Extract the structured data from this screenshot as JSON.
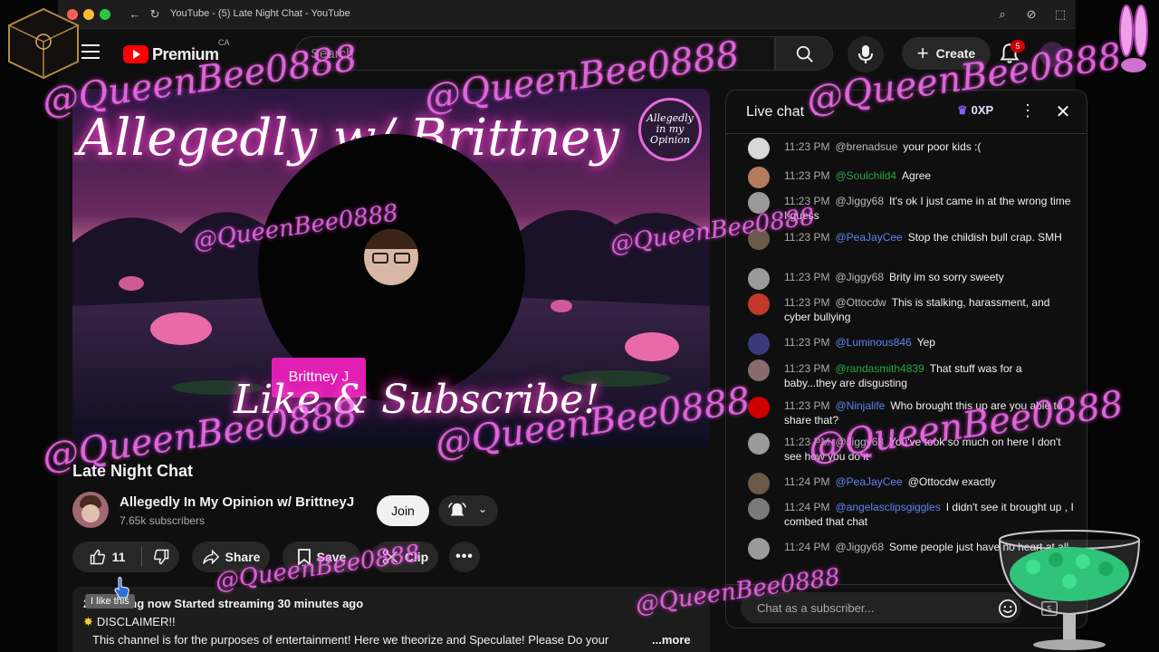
{
  "browser": {
    "tab_title": "YouTube - (5) Late Night Chat - YouTube"
  },
  "header": {
    "logo_text": "Premium",
    "logo_region": "CA",
    "search_placeholder": "Search",
    "create_label": "Create",
    "notification_count": "5"
  },
  "player": {
    "banner_title": "Allegedly w/ Brittney J",
    "banner_subtitle": "Like & Subscribe!",
    "round_logo_text": "Allegedly in my Opinion",
    "host_tag": "Brittney J"
  },
  "video": {
    "title": "Late Night Chat",
    "channel_name": "Allegedly In My Opinion w/ BrittneyJ",
    "subscribers": "7.65k subscribers",
    "join_label": "Join",
    "like_count": "11",
    "share_label": "Share",
    "save_label": "Save",
    "clip_label": "Clip",
    "tooltip": "I like this",
    "desc_line1": "2 watching now  Started streaming 30 minutes ago",
    "desc_line2": "DISCLAIMER!!",
    "desc_line3": "This channel is for the purposes of entertainment!  Here we theorize and Speculate!  Please Do your",
    "desc_more": "...more"
  },
  "chat": {
    "header_label": "Live chat",
    "xp_label": "0XP",
    "input_placeholder": "Chat as a subscriber...",
    "messages": [
      {
        "time": "11:23 PM",
        "author": "@brenadsue",
        "author_type": "regular",
        "text": "your poor kids :(",
        "avatar_color": "#d8d8d8"
      },
      {
        "time": "11:23 PM",
        "author": "@Soulchild4",
        "author_type": "member",
        "text": "Agree",
        "avatar_color": "#b47a5c"
      },
      {
        "time": "11:23 PM",
        "author": "@Jiggy68",
        "author_type": "regular",
        "text": "It's ok I just came in at the wrong time I guess",
        "avatar_color": "#9a9a9a"
      },
      {
        "time": "11:23 PM",
        "author": "@PeaJayCee",
        "author_type": "mod",
        "text": "Stop the childish bull crap. SMH",
        "avatar_color": "#6a5a4a"
      },
      {
        "time": "11:23 PM",
        "author": "@Jiggy68",
        "author_type": "regular",
        "text": "Brity im so sorry sweety",
        "avatar_color": "#9a9a9a"
      },
      {
        "time": "11:23 PM",
        "author": "@Ottocdw",
        "author_type": "regular",
        "text": "This is stalking, harassment, and cyber bullying",
        "avatar_color": "#c0392b"
      },
      {
        "time": "11:23 PM",
        "author": "@Luminous846",
        "author_type": "mod",
        "text": "Yep",
        "avatar_color": "#3a3a7a"
      },
      {
        "time": "11:23 PM",
        "author": "@randasmith4839",
        "author_type": "member",
        "text": "That stuff was for a baby...they are disgusting",
        "avatar_color": "#8a6a6a"
      },
      {
        "time": "11:23 PM",
        "author": "@Ninjalife",
        "author_type": "mod",
        "text": "Who brought this up are you able to share that?",
        "avatar_color": "#cc0000"
      },
      {
        "time": "11:23 PM",
        "author": "@Jiggy68",
        "author_type": "regular",
        "text": "You've took so much on here I don't see how you do it",
        "avatar_color": "#9a9a9a"
      },
      {
        "time": "11:24 PM",
        "author": "@PeaJayCee",
        "author_type": "mod",
        "text": "@Ottocdw exactly",
        "avatar_color": "#6a5a4a"
      },
      {
        "time": "11:24 PM",
        "author": "@angelasclipsgiggles",
        "author_type": "mod",
        "text": "I didn't see it brought up , I combed that chat",
        "avatar_color": "#7a7a7a"
      },
      {
        "time": "11:24 PM",
        "author": "@Jiggy68",
        "author_type": "regular",
        "text": "Some people just have no heart at all",
        "avatar_color": "#9a9a9a"
      }
    ]
  },
  "overlay": {
    "watermark_text": "@QueenBee0888"
  },
  "colors": {
    "accent_red": "#ff0000",
    "host_tag_pink": "#e01fb3",
    "watermark_pink": "#f478f0",
    "member_green": "#2ba640",
    "mod_blue": "#5e84f1"
  }
}
